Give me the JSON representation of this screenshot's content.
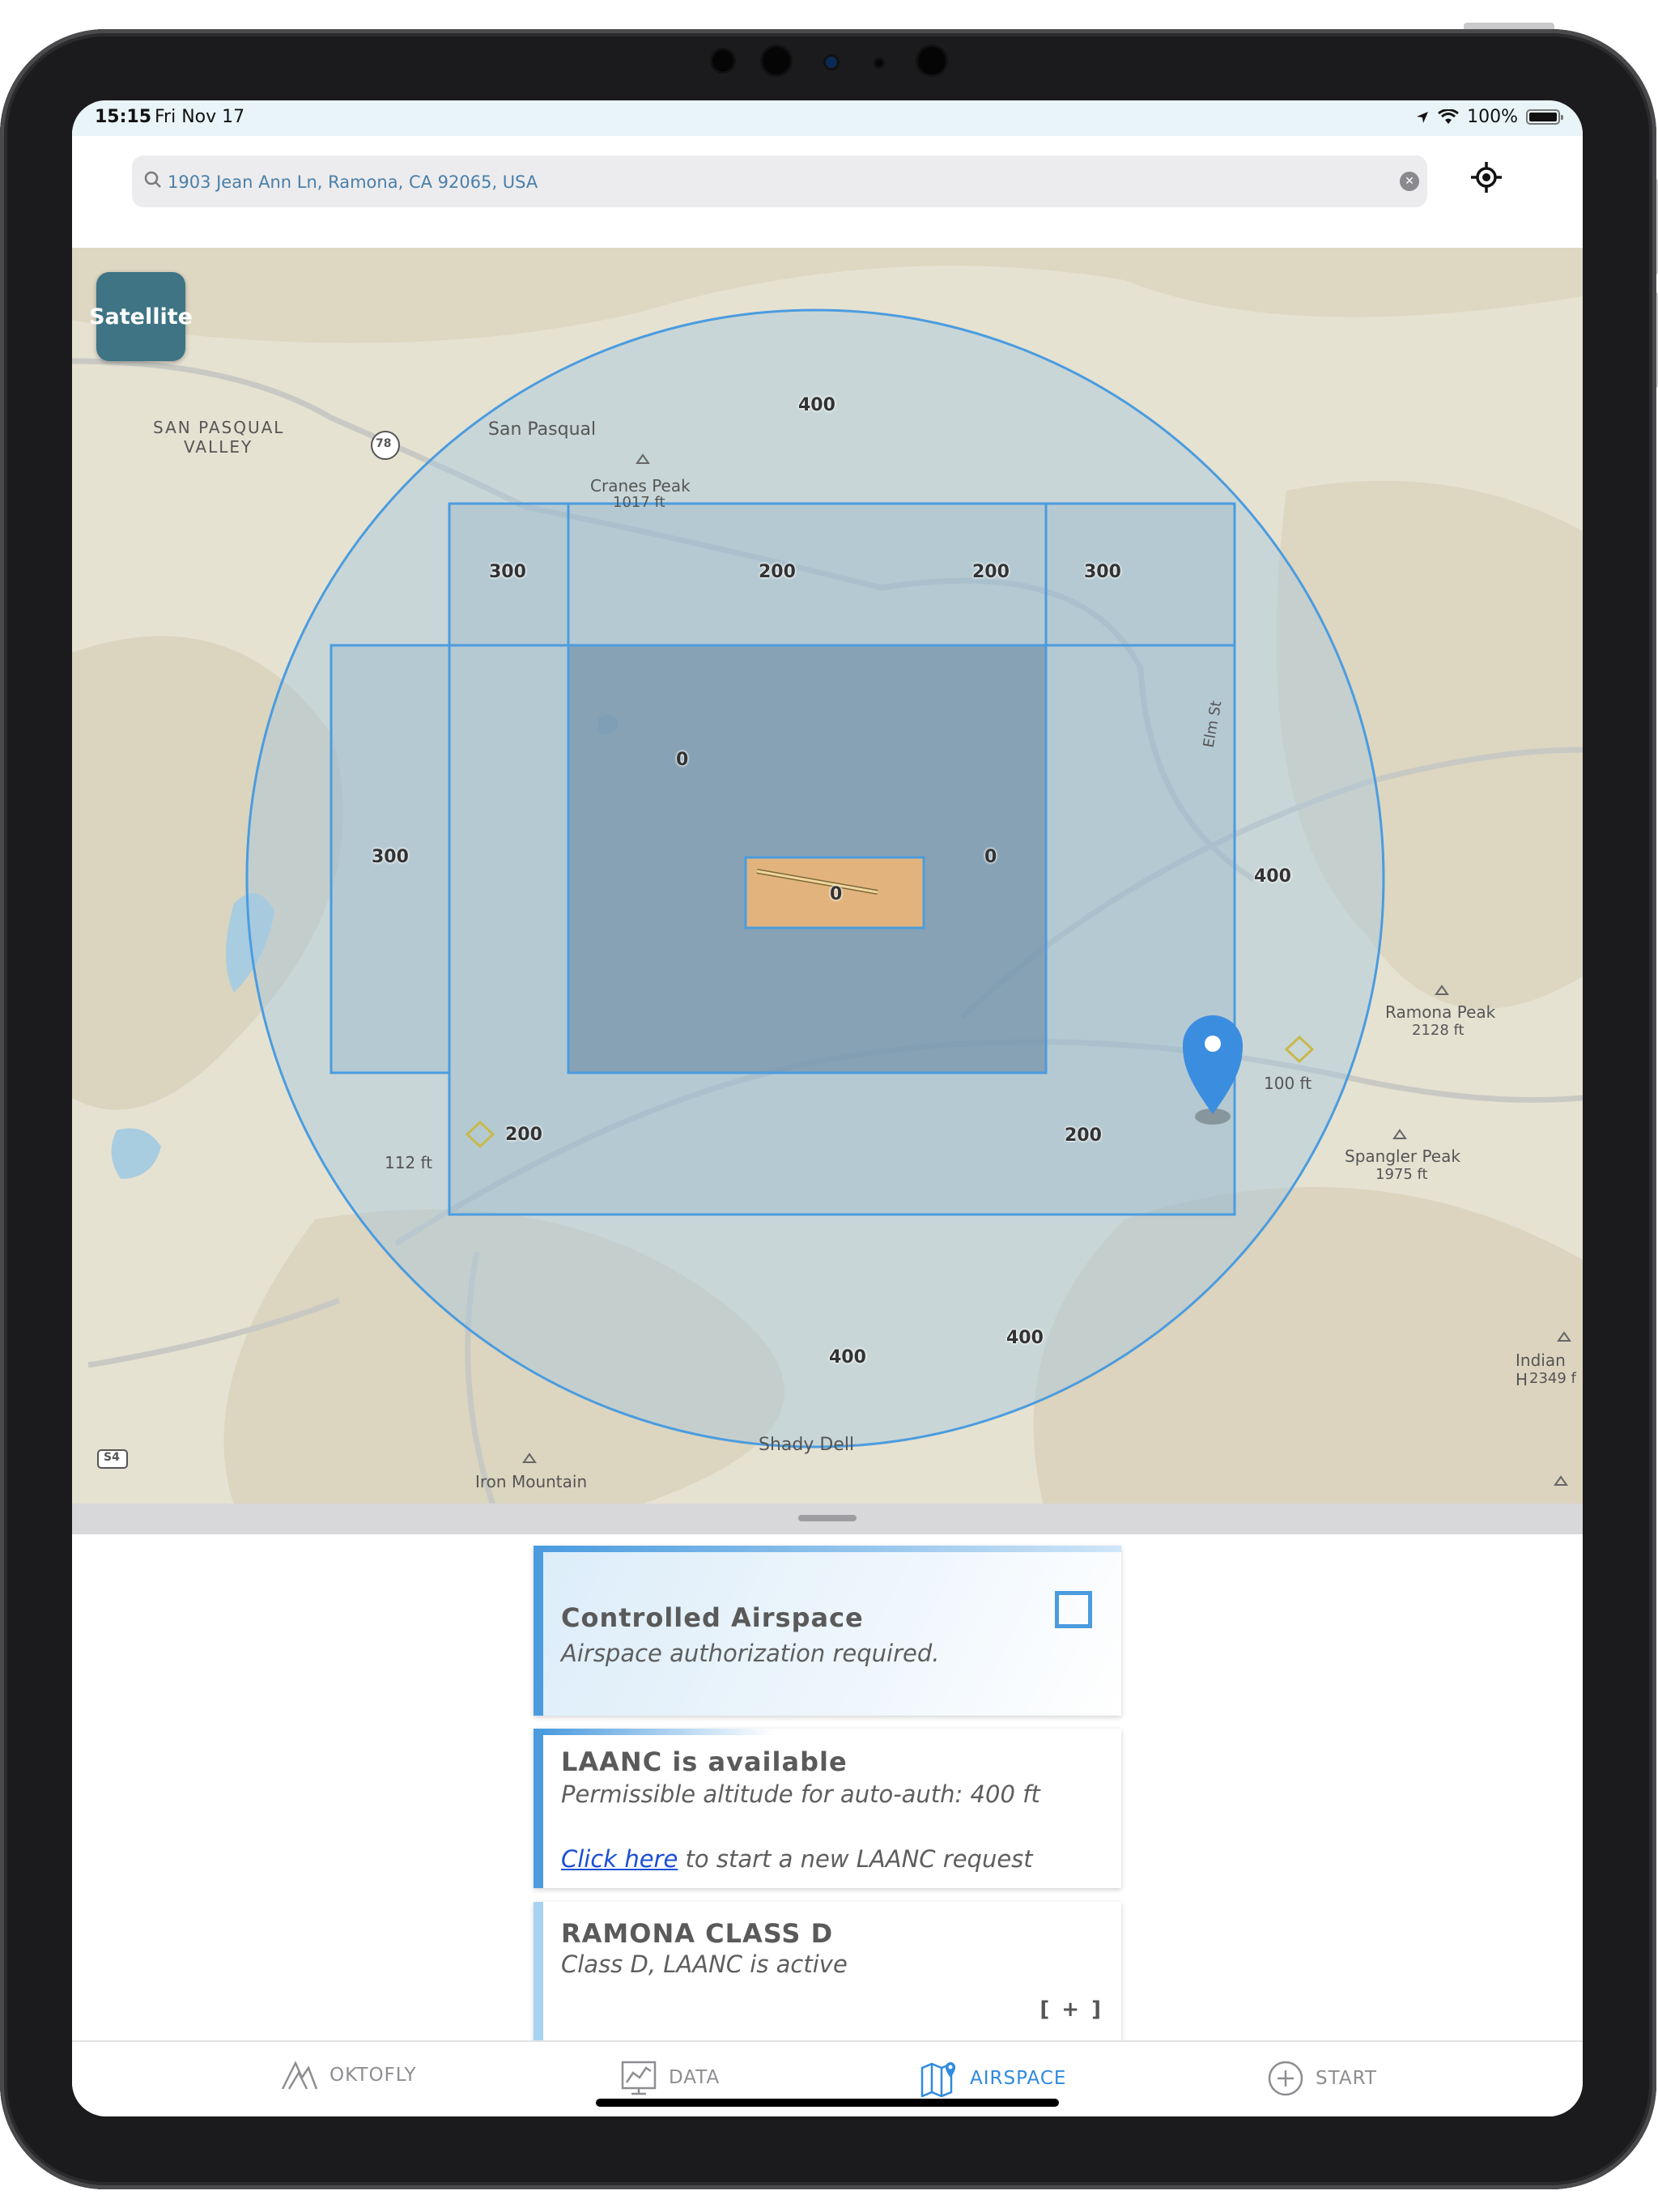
{
  "status_bar": {
    "time": "15:15",
    "date": "Fri Nov 17",
    "battery": "100%"
  },
  "search": {
    "address": "1903 Jean Ann Ln, Ramona, CA 92065, USA"
  },
  "map": {
    "satellite_button": "Satellite",
    "place_labels": [
      "SAN PASQUAL",
      "VALLEY",
      "San Pasqual",
      "Cranes Peak",
      "1017 ft",
      "Elm St",
      "Ramona Peak",
      "2128 ft",
      "Spangler Peak",
      "1975 ft",
      "Indian H",
      "2349 f",
      "Iron Mountain",
      "Shady Dell",
      "78",
      "S4"
    ],
    "altitude_markers": [
      "112 ft",
      "100 ft"
    ],
    "grid_values": [
      "400",
      "300",
      "200",
      "200",
      "300",
      "0",
      "0",
      "0",
      "300",
      "400",
      "200",
      "200",
      "400",
      "400"
    ]
  },
  "cards": {
    "controlled": {
      "title": "Controlled Airspace",
      "subtitle": "Airspace authorization required."
    },
    "laanc": {
      "title": "LAANC is available",
      "subtitle": "Permissible altitude for auto-auth: 400 ft",
      "link": "Click here",
      "link_suffix": " to start a new LAANC request"
    },
    "class_d": {
      "title": "RAMONA CLASS D",
      "subtitle": "Class D, LAANC is active",
      "expand": "[ + ]"
    }
  },
  "tabs": [
    {
      "label": "OKTOFLY",
      "icon": "oktofly-logo-icon"
    },
    {
      "label": "DATA",
      "icon": "chart-icon"
    },
    {
      "label": "AIRSPACE",
      "icon": "map-pin-icon"
    },
    {
      "label": "START",
      "icon": "plus-circle-icon"
    }
  ],
  "colors": {
    "accent": "#2f8ae0",
    "card_border": "#4b9cdf",
    "airport_fill": "#e8b47a"
  }
}
